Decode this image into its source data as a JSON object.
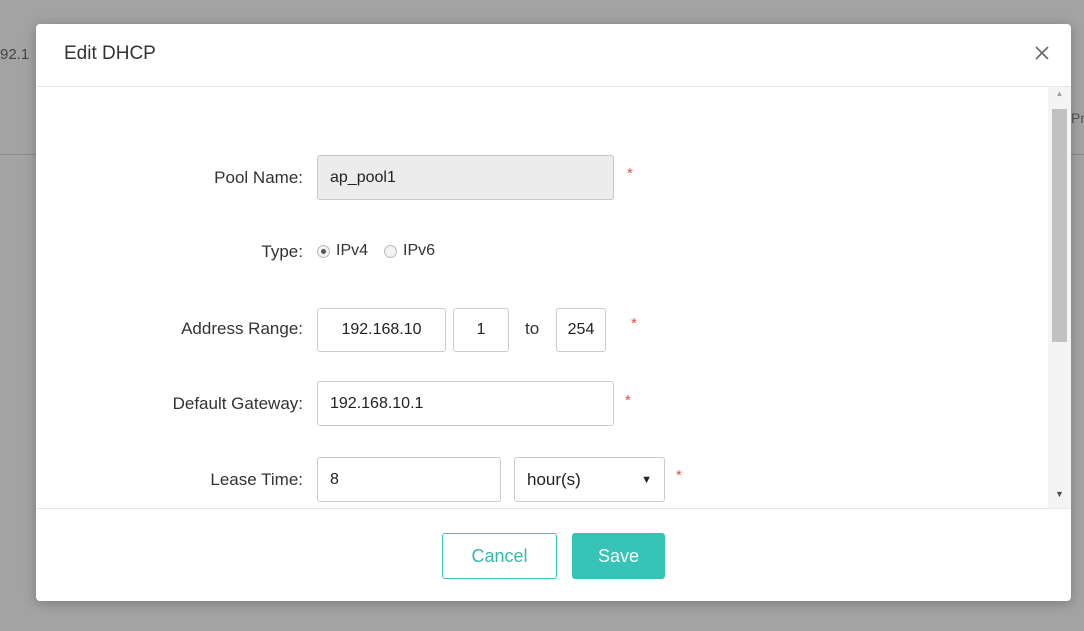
{
  "background": {
    "left_fragment": "92.1",
    "right_fragment": "Pr"
  },
  "modal": {
    "title": "Edit DHCP",
    "close_icon": "close-icon"
  },
  "form": {
    "pool_name": {
      "label": "Pool Name:",
      "value": "ap_pool1",
      "disabled": true,
      "required": "*"
    },
    "type": {
      "label": "Type:",
      "options": [
        "IPv4",
        "IPv6"
      ],
      "selected": "IPv4"
    },
    "address_range": {
      "label": "Address Range:",
      "prefix": "192.168.10",
      "start": "1",
      "to_label": "to",
      "end": "254",
      "required": "*"
    },
    "default_gateway": {
      "label": "Default Gateway:",
      "value": "192.168.10.1",
      "required": "*"
    },
    "lease_time": {
      "label": "Lease Time:",
      "value": "8",
      "unit": "hour(s)",
      "required": "*"
    }
  },
  "footer": {
    "cancel_label": "Cancel",
    "save_label": "Save"
  },
  "colors": {
    "accent": "#35c4b5",
    "required": "#e04f4f"
  }
}
